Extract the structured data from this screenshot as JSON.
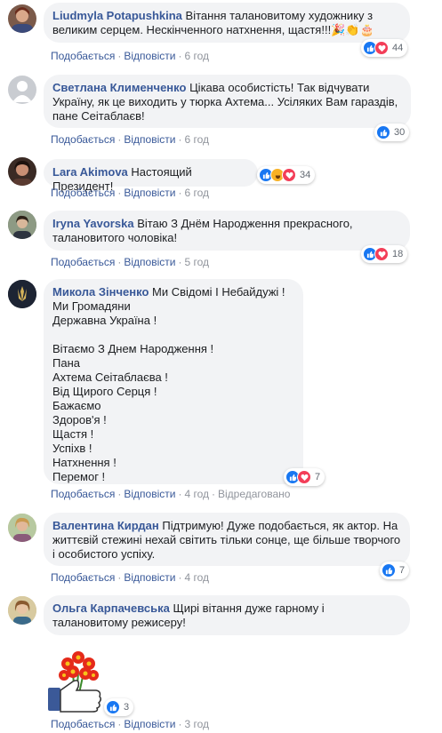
{
  "comments": [
    {
      "author": "Liudmyla Potapushkina",
      "text": "Вітання талановитому художнику з великим серцем. Нескінченного натхнення, щастя!!!🎉👏🎂",
      "like": "Подобається",
      "reply": "Відповісти",
      "time": "6 год",
      "reactions": "44"
    },
    {
      "author": "Светлана Клименченко",
      "text": "Цікава особистість! Так відчувати Україну, як це виходить у тюрка Ахтема... Усіляких Вам гараздів, пане Сеітаблаєв!",
      "like": "Подобається",
      "reply": "Відповісти",
      "time": "6 год",
      "reactions": "30"
    },
    {
      "author": "Lara Akimova",
      "text": "Настоящий Президент!",
      "like": "Подобається",
      "reply": "Відповісти",
      "time": "6 год",
      "reactions": "34"
    },
    {
      "author": "Iryna Yavorska",
      "text": "Вітаю З Днём Народження прекрасного, талановитого чоловіка!",
      "like": "Подобається",
      "reply": "Відповісти",
      "time": "5 год",
      "reactions": "18"
    },
    {
      "author": "Микола Зінченко",
      "text": "Ми Свідомі І Небайдужі !\nМи Громадяни\nДержавна Україна !\n\nВітаємо З Днем Народження !\nПана\nАхтема Сеітаблаєва !\nВід Щирого Серця !\nБажаємо\nЗдоров'я !\nЩастя !\nУспіхв !\nНатхнення !\nПеремог !",
      "like": "Подобається",
      "reply": "Відповісти",
      "time": "4 год",
      "edited": "Відредаговано",
      "reactions": "7"
    },
    {
      "author": "Валентина Кирдан",
      "text": "Підтримую! Дуже подобається, як актор. На життєвій стежині нехай світить тільки сонце, ще більше творчого і особистого успіху.",
      "like": "Подобається",
      "reply": "Відповісти",
      "time": "4 год",
      "reactions": "7"
    },
    {
      "author": "Ольга Карпачевська",
      "text": "Щирі вітання дуже гарному і талановитому режисеру!",
      "like": "Подобається",
      "reply": "Відповісти",
      "time": "3 год",
      "reactions": "3"
    }
  ],
  "colors": {
    "link": "#385898",
    "bubble": "#f2f3f5",
    "like": "#1877f2",
    "love": "#f33e58",
    "haha": "#f7b125"
  }
}
